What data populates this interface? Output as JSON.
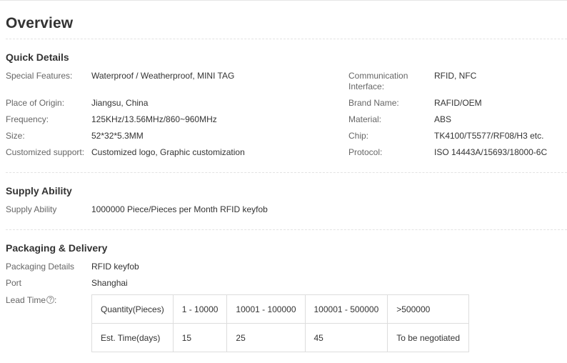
{
  "overview": {
    "title": "Overview"
  },
  "quick_details": {
    "title": "Quick Details",
    "left": [
      {
        "label": "Special Features:",
        "value": "Waterproof / Weatherproof, MINI TAG"
      },
      {
        "label": "Place of Origin:",
        "value": "Jiangsu, China"
      },
      {
        "label": "Frequency:",
        "value": "125KHz/13.56MHz/860~960MHz"
      },
      {
        "label": "Size:",
        "value": "52*32*5.3MM"
      },
      {
        "label": "Customized support:",
        "value": "Customized logo, Graphic customization"
      }
    ],
    "right": [
      {
        "label_line1": "Communication",
        "label_line2": "Interface:",
        "value": "RFID, NFC"
      },
      {
        "label": "Brand Name:",
        "value": "RAFID/OEM"
      },
      {
        "label": "Material:",
        "value": "ABS"
      },
      {
        "label": "Chip:",
        "value": "TK4100/T5577/RF08/H3 etc."
      },
      {
        "label": "Protocol:",
        "value": "ISO 14443A/15693/18000-6C"
      }
    ]
  },
  "supply_ability": {
    "title": "Supply Ability",
    "label": "Supply Ability",
    "value": "1000000 Piece/Pieces per Month RFID keyfob"
  },
  "packaging_delivery": {
    "title": "Packaging & Delivery",
    "packaging_label": "Packaging Details",
    "packaging_value": "RFID keyfob",
    "port_label": "Port",
    "port_value": "Shanghai",
    "lead_label": "Lead Time",
    "lead_colon": ":",
    "help_icon": "question-circle-icon",
    "help_glyph": "?",
    "lead_table": {
      "header": [
        "Quantity(Pieces)",
        "1 - 10000",
        "10001 - 100000",
        "100001 - 500000",
        ">500000"
      ],
      "row": [
        "Est. Time(days)",
        "15",
        "25",
        "45",
        "To be negotiated"
      ]
    }
  }
}
